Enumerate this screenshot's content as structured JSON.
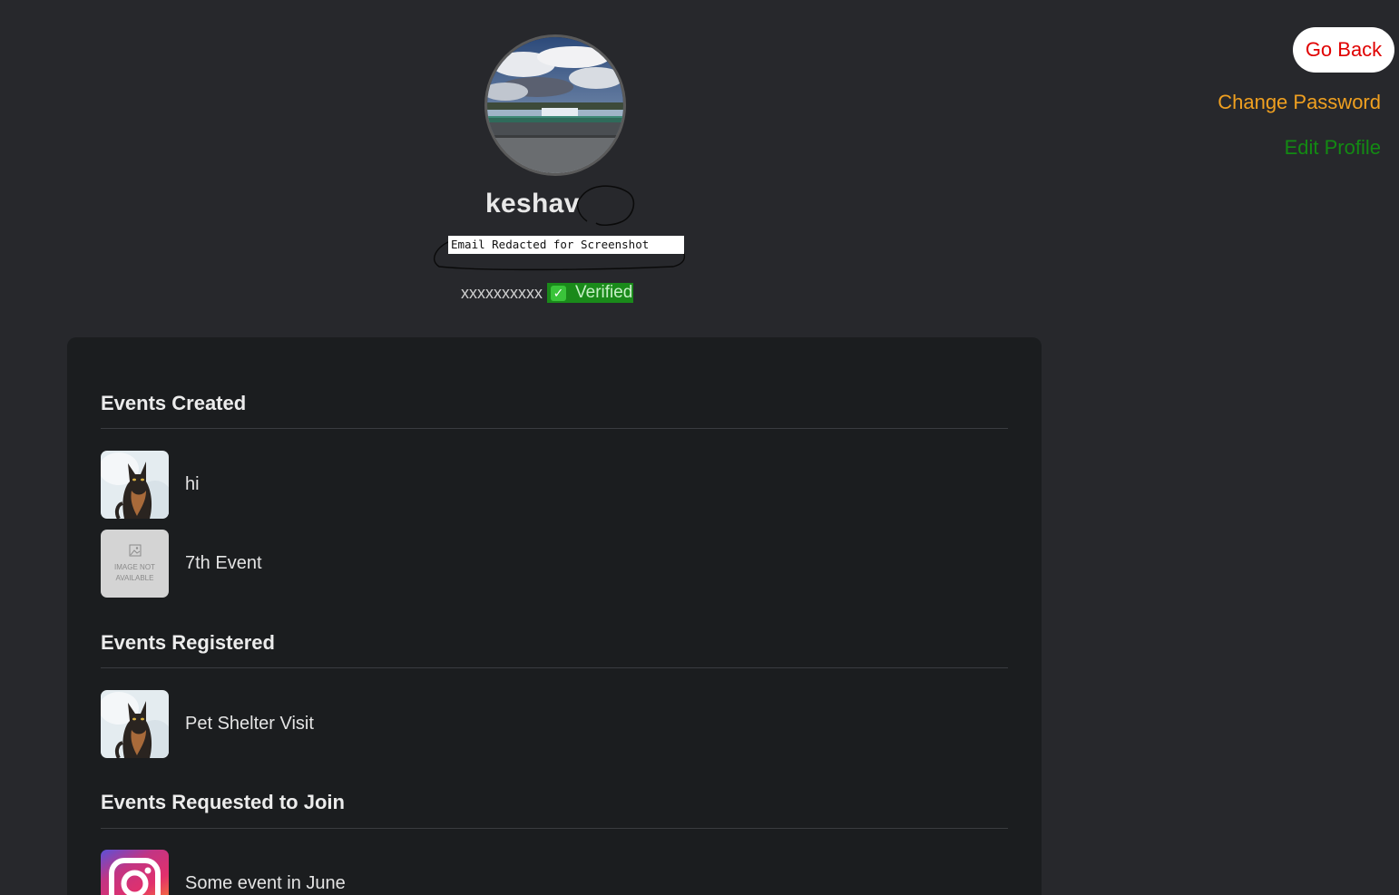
{
  "profile": {
    "username": "keshav",
    "email": "Email Redacted for Screenshot",
    "phone": "xxxxxxxxxx",
    "verified_icon": "✓",
    "verified_label": "Verified"
  },
  "actions": {
    "go_back": "Go Back",
    "change_password": "Change Password",
    "edit_profile": "Edit Profile"
  },
  "sections": {
    "created": {
      "title": "Events Created",
      "items": [
        {
          "name": "hi",
          "thumb": "cat-photo"
        },
        {
          "name": "7th Event",
          "thumb": "image-not-available",
          "placeholder_text": "IMAGE NOT AVAILABLE"
        }
      ]
    },
    "registered": {
      "title": "Events Registered",
      "items": [
        {
          "name": "Pet Shelter Visit",
          "thumb": "cat-photo"
        }
      ]
    },
    "requested": {
      "title": "Events Requested to Join",
      "items": [
        {
          "name": "Some event in June",
          "thumb": "instagram-logo"
        }
      ]
    }
  },
  "colors": {
    "background": "#27282c",
    "panel": "#1b1d1f",
    "go_back_text": "#e00000",
    "change_password": "#f0a020",
    "edit_profile": "#138a13",
    "verified_bg": "#1a8a1a"
  }
}
